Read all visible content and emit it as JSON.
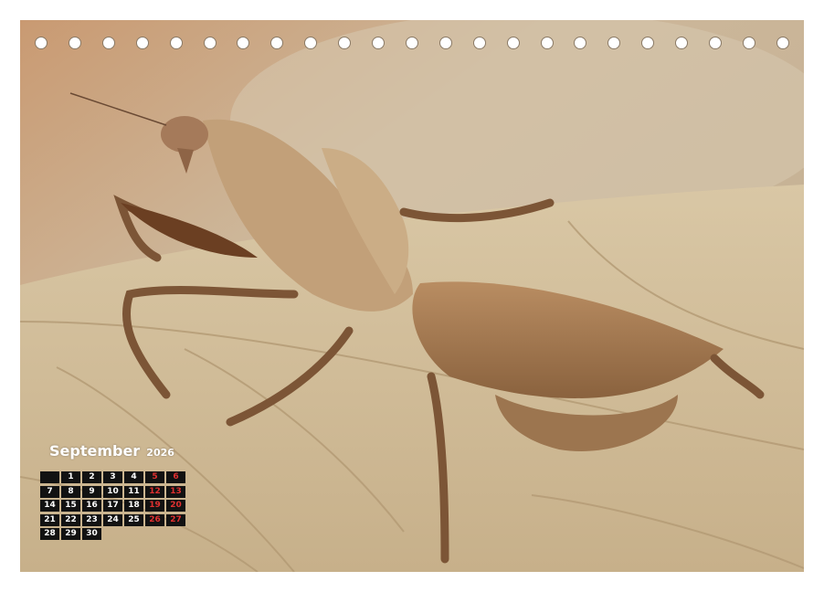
{
  "calendar": {
    "month": "September",
    "year": "2026",
    "weeks": [
      [
        "",
        "1",
        "2",
        "3",
        "4",
        "5",
        "6"
      ],
      [
        "7",
        "8",
        "9",
        "10",
        "11",
        "12",
        "13"
      ],
      [
        "14",
        "15",
        "16",
        "17",
        "18",
        "19",
        "20"
      ],
      [
        "21",
        "22",
        "23",
        "24",
        "25",
        "26",
        "27"
      ],
      [
        "28",
        "29",
        "30",
        "",
        "",
        "",
        ""
      ]
    ],
    "weekend_color": "#e03030"
  },
  "binding": {
    "hole_count": 23
  },
  "photo": {
    "subject": "dead-leaf-mantis-on-dry-leaf",
    "palette": [
      "#c9b08e",
      "#a47e58",
      "#d8c6a6",
      "#6b4a2e"
    ]
  }
}
